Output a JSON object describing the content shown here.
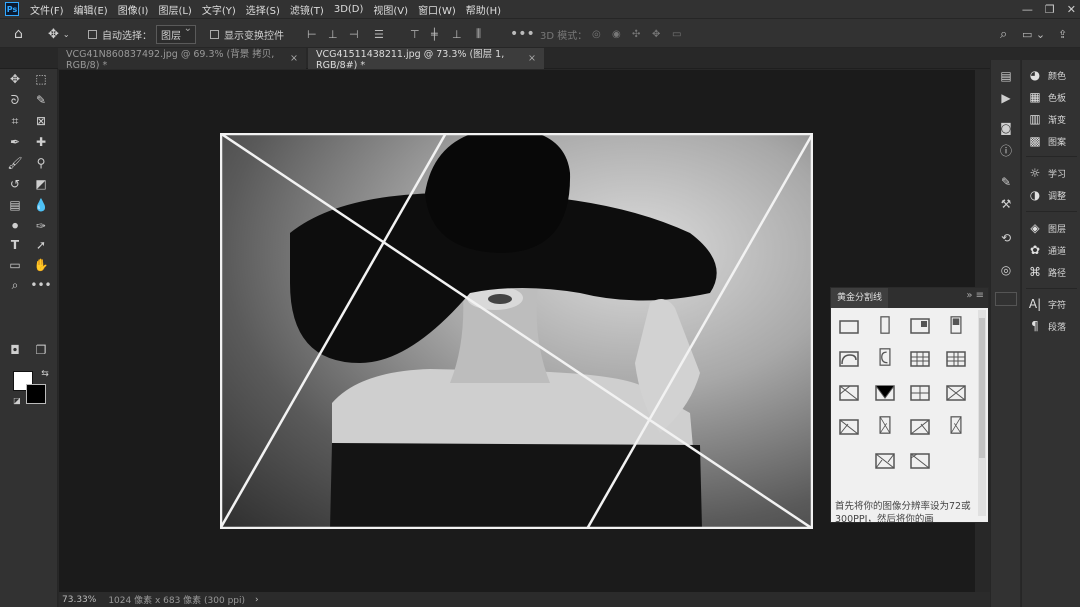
{
  "app": {
    "logo": "Ps"
  },
  "menu": [
    "文件(F)",
    "编辑(E)",
    "图像(I)",
    "图层(L)",
    "文字(Y)",
    "选择(S)",
    "滤镜(T)",
    "3D(D)",
    "视图(V)",
    "窗口(W)",
    "帮助(H)"
  ],
  "options": {
    "auto_select_label": "自动选择：",
    "layer_select": "图层",
    "show_transform_label": "显示变换控件",
    "mode_3d_label": "3D 模式："
  },
  "tabs": [
    {
      "label": "VCG41N860837492.jpg @ 69.3% (背景 拷贝, RGB/8) *",
      "close": "×"
    },
    {
      "label": "VCG41511438211.jpg @ 73.3% (图层 1, RGB/8#) *",
      "close": "×"
    }
  ],
  "status": {
    "zoom": "73.33%",
    "doc_info": "1024 像素 x 683 像素 (300 ppi)",
    "arrow": "›"
  },
  "right_panel": {
    "group1": [
      "颜色",
      "色板",
      "渐变",
      "图案"
    ],
    "group2": [
      "学习",
      "调整"
    ],
    "group3": [
      "图层",
      "通道",
      "路径"
    ],
    "group4": [
      "字符",
      "段落"
    ]
  },
  "golden_panel": {
    "title": "黄金分割线",
    "controls": "»  ≡",
    "description": "首先将你的图像分辨率设为72或300PPI，然后将你的画"
  },
  "icons": {
    "home": "home-icon",
    "move": "move-icon",
    "accent": "#31a8ff",
    "panel_bg": "#323232",
    "canvas_bg": "#1b1b1b"
  }
}
